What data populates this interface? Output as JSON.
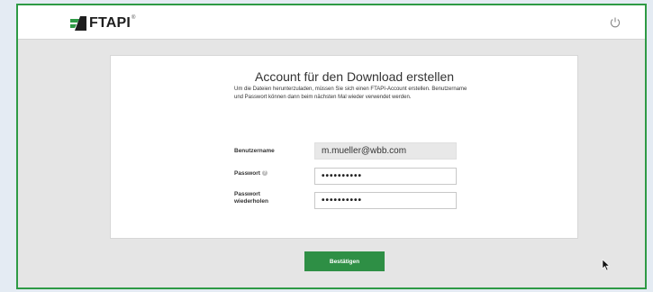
{
  "header": {
    "logo_text": "FTAPI",
    "logo_reg": "®",
    "power_icon": "power-icon"
  },
  "card": {
    "title": "Account für den Download erstellen",
    "intro": "Um die Dateien herunterzuladen, müssen Sie sich einen FTAPI-Account erstellen. Benutzername und Passwort können dann beim nächsten Mal wieder verwendet werden.",
    "username_label": "Benutzername",
    "username_value": "m.mueller@wbb.com",
    "password_label": "Passwort",
    "password_value": "••••••••••",
    "password_repeat_label_1": "Passwort",
    "password_repeat_label_2": "wiederholen",
    "password_repeat_value": "••••••••••"
  },
  "actions": {
    "confirm_label": "Bestätigen"
  },
  "colors": {
    "accent": "#2e8f45",
    "frame_border": "#2e9a45",
    "page_bg": "#e5e5e5"
  }
}
